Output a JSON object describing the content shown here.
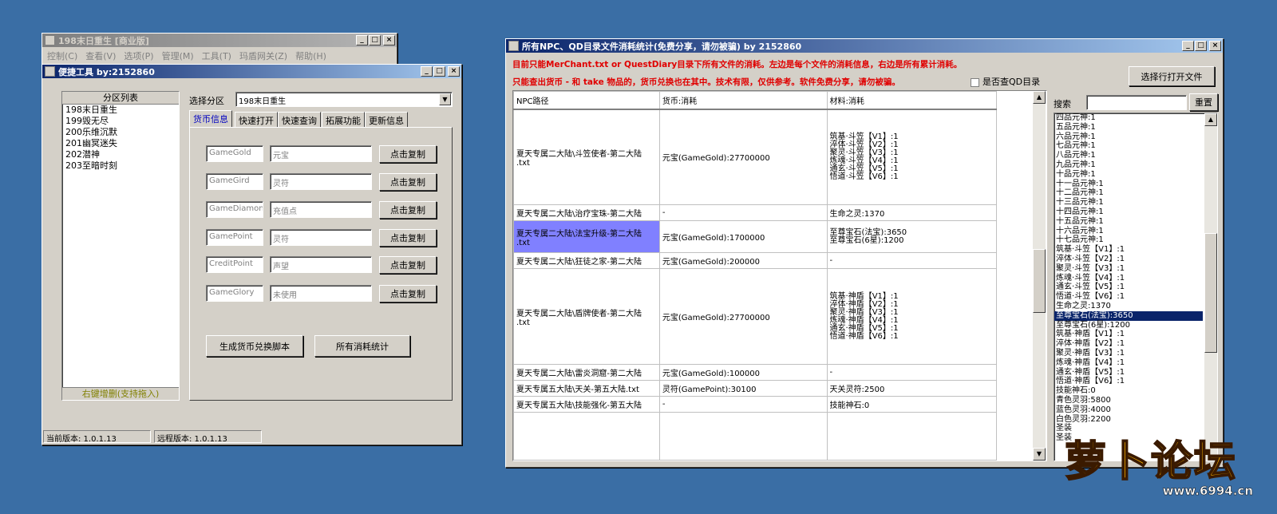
{
  "main_window": {
    "title": "198末日重生 [商业版]",
    "menu": [
      "控制(C)",
      "查看(V)",
      "选项(P)",
      "管理(M)",
      "工具(T)",
      "玛盾网关(Z)",
      "帮助(H)"
    ]
  },
  "tool_window": {
    "title": "便捷工具  by:2152860",
    "list_header": "分区列表",
    "list_items": [
      "198末日重生",
      "199毁无尽",
      "200乐维沉默",
      "201幽冥迷失",
      "202潜神",
      "203至暗时刻"
    ],
    "list_footer": "右键增删(支持拖入)",
    "select_label": "选择分区",
    "select_value": "198末日重生",
    "tabs": [
      "货币信息",
      "快速打开",
      "快速查询",
      "拓展功能",
      "更新信息"
    ],
    "currencies": [
      {
        "code": "GameGold",
        "name": "元宝"
      },
      {
        "code": "GameGird",
        "name": "灵符"
      },
      {
        "code": "GameDiamond",
        "name": "充值点"
      },
      {
        "code": "GamePoint",
        "name": "灵符"
      },
      {
        "code": "CreditPoint",
        "name": "声望"
      },
      {
        "code": "GameGlory",
        "name": "未使用"
      }
    ],
    "copy_label": "点击复制",
    "gen_button": "生成货币兑换脚本",
    "stats_button": "所有消耗统计",
    "status_current": "当前版本: 1.0.1.13",
    "status_remote": "远程版本: 1.0.1.13"
  },
  "stats_window": {
    "title": "所有NPC、QD目录文件消耗统计(免费分享，请勿被骗)     by 2152860",
    "notice1": "目前只能MerChant.txt or QuestDiary目录下所有文件的消耗。左边是每个文件的消耗信息，右边是所有累计消耗。",
    "notice2": "只能查出货币 - 和 take 物品的，货币兑换也在其中。技术有限，仅供参考。软件免费分享，请勿被骗。",
    "check_label": "是否查QD目录",
    "open_button": "选择行打开文件",
    "search_label": "搜索",
    "reset_button": "重置",
    "columns": [
      "NPC路径",
      "货币:消耗",
      "材料:消耗"
    ],
    "rows": [
      {
        "path": "夏天专属二大陆\\斗笠使者-第二大陆",
        "path2": ".txt",
        "currency": "元宝(GameGold):27700000",
        "mats": [
          "筑基·斗笠【V1】:1",
          "淬体·斗笠【V2】:1",
          "聚灵·斗笠【V3】:1",
          "炼魂·斗笠【V4】:1",
          "通玄·斗笠【V5】:1",
          "悟道·斗笠【V6】:1"
        ]
      },
      {
        "path": "夏天专属二大陆\\治疗宝珠-第二大陆",
        "path2": "",
        "currency": "-",
        "mats": [
          "生命之灵:1370"
        ]
      },
      {
        "path": "夏天专属二大陆\\法宝升级-第二大陆",
        "path2": ".txt",
        "currency": "元宝(GameGold):1700000",
        "mats": [
          "至尊宝石(法宝):3650",
          "至尊宝石(6星):1200"
        ]
      },
      {
        "path": "夏天专属二大陆\\狂徒之家-第二大陆",
        "path2": "",
        "currency": "元宝(GameGold):200000",
        "mats": [
          "-"
        ]
      },
      {
        "path": "夏天专属二大陆\\盾牌使者-第二大陆",
        "path2": ".txt",
        "currency": "元宝(GameGold):27700000",
        "mats": [
          "筑基·神盾【V1】:1",
          "淬体·神盾【V2】:1",
          "聚灵·神盾【V3】:1",
          "炼魂·神盾【V4】:1",
          "通玄·神盾【V5】:1",
          "悟道·神盾【V6】:1"
        ]
      },
      {
        "path": "夏天专属二大陆\\雷炎洞窟-第二大陆",
        "path2": "",
        "currency": "元宝(GameGold):100000",
        "mats": [
          "-"
        ]
      },
      {
        "path": "夏天专属五大陆\\天关-第五大陆.txt",
        "path2": "",
        "currency": "灵符(GamePoint):30100",
        "mats": [
          "天关灵符:2500"
        ]
      },
      {
        "path": "夏天专属五大陆\\技能强化-第五大陆",
        "path2": "",
        "currency": "-",
        "mats": [
          "技能神石:0"
        ]
      }
    ],
    "totals": [
      "四品元神:1",
      "五品元神:1",
      "六品元神:1",
      "七品元神:1",
      "八品元神:1",
      "九品元神:1",
      "十品元神:1",
      "十一品元神:1",
      "十二品元神:1",
      "十三品元神:1",
      "十四品元神:1",
      "十五品元神:1",
      "十六品元神:1",
      "十七品元神:1",
      "筑基·斗笠【V1】:1",
      "淬体·斗笠【V2】:1",
      "聚灵·斗笠【V3】:1",
      "炼魂·斗笠【V4】:1",
      "通玄·斗笠【V5】:1",
      "悟道·斗笠【V6】:1",
      "生命之灵:1370",
      "至尊宝石(法宝):3650",
      "至尊宝石(6星):1200",
      "筑基·神盾【V1】:1",
      "淬体·神盾【V2】:1",
      "聚灵·神盾【V3】:1",
      "炼魂·神盾【V4】:1",
      "通玄·神盾【V5】:1",
      "悟道·神盾【V6】:1",
      "技能神石:0",
      "青色灵羽:5800",
      "蓝色灵羽:4000",
      "白色灵羽:2200",
      "圣装",
      "圣装"
    ]
  },
  "watermark": {
    "brand": "萝卜论坛",
    "url": "www.6994.cn"
  }
}
